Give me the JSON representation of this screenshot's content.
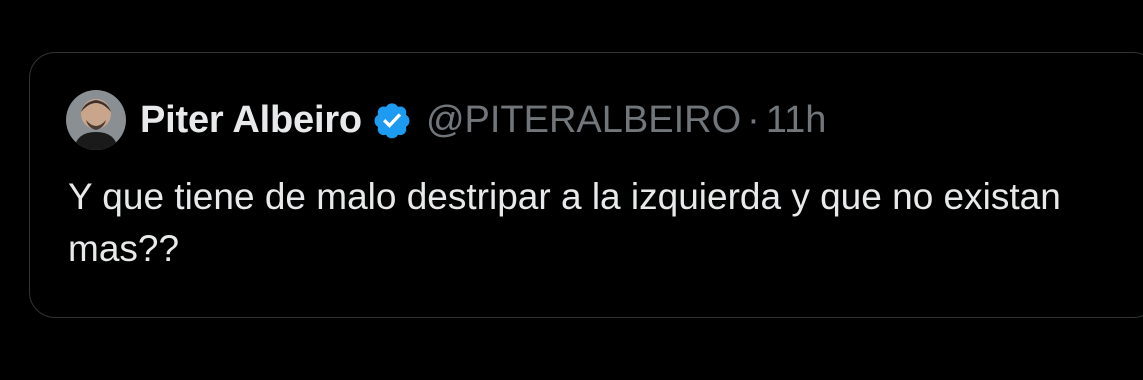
{
  "tweet": {
    "author_name": "Piter Albeiro",
    "handle": "@PITERALBEIRO",
    "separator": "·",
    "time": "11h",
    "verified": true,
    "text": "Y que tiene de malo destripar a la izquierda y que no existan mas??"
  },
  "icons": {
    "avatar": "avatar-photo",
    "badge": "verified-badge-icon"
  },
  "colors": {
    "background": "#000000",
    "border": "#2f3336",
    "primary_text": "#e7e9ea",
    "secondary_text": "#71767b",
    "verified_blue": "#1d9bf0"
  }
}
